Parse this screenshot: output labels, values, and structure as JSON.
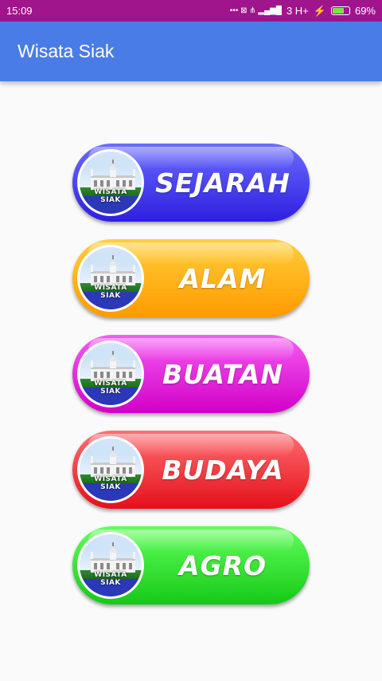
{
  "status_bar": {
    "time": "15:09",
    "icons": "••• ⊠ ⋔ ▂▄▆█",
    "network": "3 H+",
    "battery": "69%",
    "battery_level": 0.69
  },
  "app_bar": {
    "title": "Wisata Siak"
  },
  "logo_text": [
    "WISATA",
    "SIAK"
  ],
  "menu": [
    {
      "label": "SEJARAH",
      "color_top": "#6a6cff",
      "color_bottom": "#2e1fe0"
    },
    {
      "label": "ALAM",
      "color_top": "#ffcf3a",
      "color_bottom": "#ff9a00"
    },
    {
      "label": "BUATAN",
      "color_top": "#f55df2",
      "color_bottom": "#d200c9"
    },
    {
      "label": "BUDAYA",
      "color_top": "#ff6f73",
      "color_bottom": "#e5101a"
    },
    {
      "label": "AGRO",
      "color_top": "#62ff5c",
      "color_bottom": "#16c916"
    }
  ]
}
